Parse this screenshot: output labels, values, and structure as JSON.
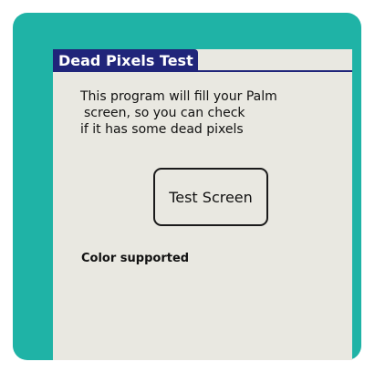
{
  "app": {
    "title": "Dead Pixels Test"
  },
  "main": {
    "description_lines": [
      "This program will fill your Palm",
      "screen, so you can check",
      "if it has some dead pixels"
    ],
    "test_button_label": "Test Screen",
    "status_text": "Color supported"
  },
  "colors": {
    "frame": "#1fb3a6",
    "screen_background": "#e9e8e1",
    "title_bar": "#20257a",
    "text": "#111111"
  }
}
